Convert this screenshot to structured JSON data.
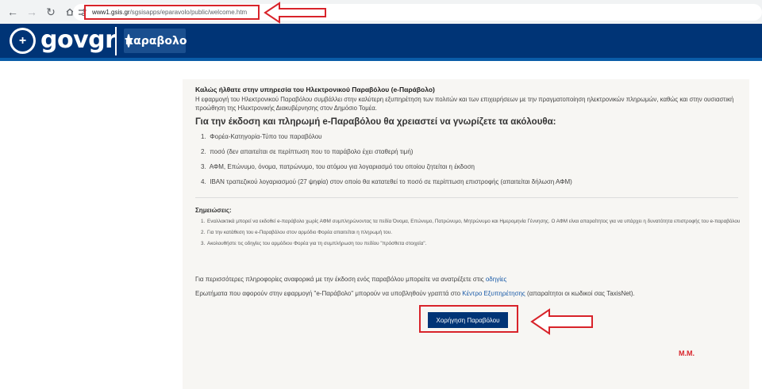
{
  "browser": {
    "url_host": "www1.gsis.gr",
    "url_path": "/sgsisapps/eparavolo/public/welcome.htm",
    "back_icon": "arrow-left-icon",
    "forward_icon": "arrow-right-icon",
    "reload_icon": "reload-icon",
    "home_icon": "home-icon"
  },
  "header": {
    "brand": "govgr",
    "service_logo": "παραβολο"
  },
  "main": {
    "welcome_title": "Καλώς ήλθατε στην υπηρεσία του Ηλεκτρονικού Παραβόλου (e-Παράβολο)",
    "intro": "Η εφαρμογή του Ηλεκτρονικού Παραβόλου συμβάλλει στην καλύτερη εξυπηρέτηση των πολιτών και των επιχειρήσεων με την πραγματοποίηση ηλεκτρονικών πληρωμών, καθώς και στην ουσιαστική προώθηση της Ηλεκτρονικής Διακυβέρνησης στον Δημόσιο Τομέα.",
    "section_title": "Για την έκδοση και πληρωμή e-Παραβόλου θα χρειαστεί να γνωρίζετε τα ακόλουθα:",
    "requirements": [
      {
        "num": "1.",
        "text": "Φορέα-Κατηγορία-Τύπο του παραβόλου"
      },
      {
        "num": "2.",
        "text": "ποσό (δεν απαιτείται σε περίπτωση που το παράβολο έχει σταθερή τιμή)"
      },
      {
        "num": "3.",
        "text": "ΑΦΜ, Επώνυμο, όνομα, πατρώνυμο, του ατόμου για λογαριασμό του οποίου ζητείται η έκδοση"
      },
      {
        "num": "4.",
        "text": "IBAN τραπεζικού λογαριασμού (27 ψηφία) στον οποίο θα κατατεθεί το ποσό σε περίπτωση επιστροφής (απαιτείται δήλωση ΑΦΜ)"
      }
    ],
    "notes_title": "Σημειώσεις:",
    "notes": [
      {
        "num": "1.",
        "text": "Εναλλακτικά μπορεί να εκδοθεί e-παράβολο χωρίς ΑΦΜ συμπληρώνοντας τα πεδία Όνομα, Επώνυμο, Πατρώνυμο, Μητρώνυμο και Ημερομηνία Γέννησης. Ο ΑΦΜ είναι απαραίτητος για να υπάρχει η δυνατότητα επιστροφής του e-παραβόλου"
      },
      {
        "num": "2.",
        "text": "Για την κατάθεση του e-Παραβόλου στον αρμόδιο Φορέα απαιτείται η πληρωμή του."
      },
      {
        "num": "3.",
        "text": "Ακολουθήστε τις οδηγίες του αρμόδιου Φορέα για τη συμπλήρωση του πεδίου \"πρόσθετα στοιχεία\"."
      }
    ],
    "more_info_text": "Για περισσότερες πληροφορίες αναφορικά με την έκδοση ενός παραβόλου μπορείτε να ανατρέξετε στις",
    "more_info_link": "οδηγίες",
    "questions_text": "Ερωτήματα που αφορούν στην εφαρμογή \"e-Παράβολο\" μπορούν να υποβληθούν γραπτά στο",
    "questions_link": "Κέντρο Εξυπηρέτησης",
    "questions_suffix": "(απαραίτητοι οι κωδικοί σας TaxisNet).",
    "issue_button": "Χορήγηση Παραβόλου"
  },
  "annotation": {
    "signature": "Μ.Μ.",
    "color": "#d8232a"
  }
}
